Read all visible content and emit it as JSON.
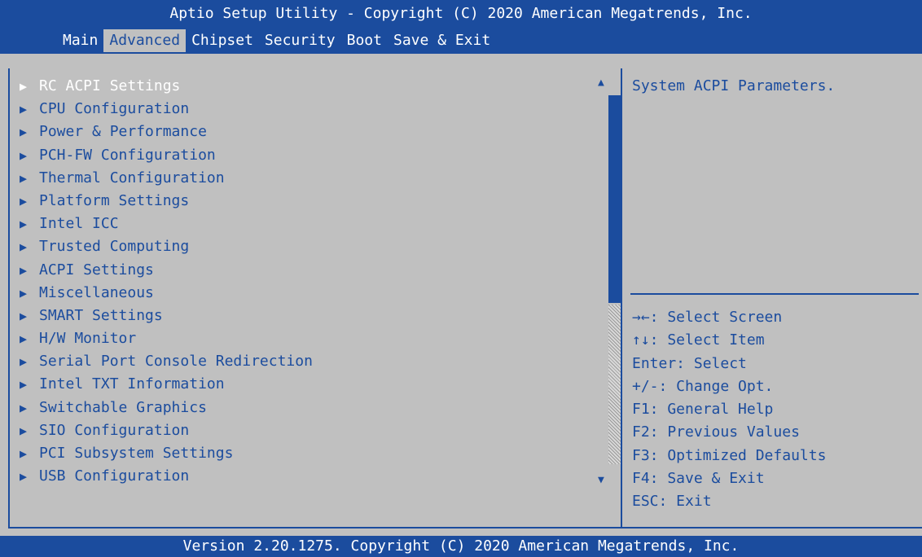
{
  "header": {
    "title": "Aptio Setup Utility - Copyright (C) 2020 American Megatrends, Inc."
  },
  "tabs": [
    {
      "label": "Main"
    },
    {
      "label": "Advanced"
    },
    {
      "label": "Chipset"
    },
    {
      "label": "Security"
    },
    {
      "label": "Boot"
    },
    {
      "label": "Save & Exit"
    }
  ],
  "active_tab": "Advanced",
  "menu_items": [
    {
      "label": "RC ACPI Settings"
    },
    {
      "label": "CPU Configuration"
    },
    {
      "label": "Power & Performance"
    },
    {
      "label": "PCH-FW Configuration"
    },
    {
      "label": "Thermal Configuration"
    },
    {
      "label": "Platform Settings"
    },
    {
      "label": "Intel ICC"
    },
    {
      "label": "Trusted Computing"
    },
    {
      "label": "ACPI Settings"
    },
    {
      "label": "Miscellaneous"
    },
    {
      "label": "SMART Settings"
    },
    {
      "label": "H/W Monitor"
    },
    {
      "label": "Serial Port Console Redirection"
    },
    {
      "label": "Intel TXT Information"
    },
    {
      "label": "Switchable Graphics"
    },
    {
      "label": "SIO Configuration"
    },
    {
      "label": "PCI Subsystem Settings"
    },
    {
      "label": "USB Configuration"
    }
  ],
  "selected_item": "RC ACPI Settings",
  "help": {
    "text": "System ACPI Parameters."
  },
  "keys": [
    "→←: Select Screen",
    "↑↓: Select Item",
    "Enter: Select",
    "+/-: Change Opt.",
    "F1: General Help",
    "F2: Previous Values",
    "F3: Optimized Defaults",
    "F4: Save & Exit",
    "ESC: Exit"
  ],
  "footer": {
    "version": "Version 2.20.1275. Copyright (C) 2020 American Megatrends, Inc."
  },
  "colors": {
    "bar_blue": "#1b4c9e",
    "background_gray": "#c0c0c0",
    "selected_text": "#ffffff"
  },
  "icons": {
    "submenu_arrow": "right-triangle-icon",
    "scroll_up": "scroll-up-arrow-icon",
    "scroll_down": "scroll-down-arrow-icon"
  }
}
